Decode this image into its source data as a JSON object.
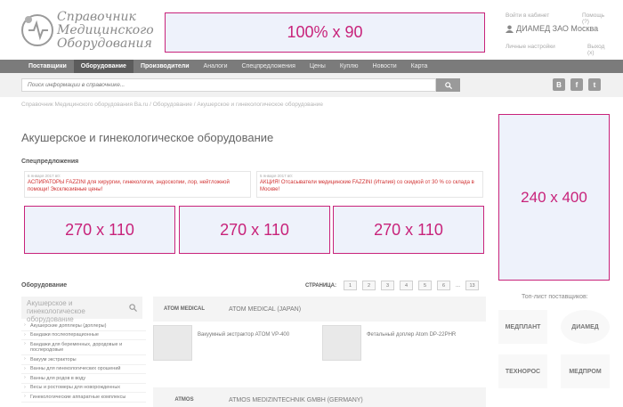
{
  "header": {
    "logo_lines": [
      "Справочник",
      "Медицинского",
      "Оборудования"
    ],
    "top_banner_label": "100% x 90"
  },
  "account": {
    "cabinet_link": "Войти в кабинет",
    "help_link": "Помощь (?)",
    "username": "ДИАМЕД ЗАО Москва",
    "settings_link": "Личные настройки",
    "logout_link": "Выход (x)"
  },
  "nav": {
    "items": [
      {
        "label": "Поставщики"
      },
      {
        "label": "Оборудование"
      },
      {
        "label": "Производители"
      },
      {
        "label": "Аналоги"
      },
      {
        "label": "Спецпредложения"
      },
      {
        "label": "Цены"
      },
      {
        "label": "Куплю"
      },
      {
        "label": "Новости"
      },
      {
        "label": "Карта"
      }
    ]
  },
  "search": {
    "placeholder": "Поиск информации в справочнике..."
  },
  "social": {
    "vk": "В",
    "fb": "f",
    "tw": "t"
  },
  "breadcrumb": "Справочник Медицинского оборудования Ва.ru / Оборудование / Акушерское и гинекологическое оборудование",
  "page_title": "Акушерское и гинекологическое оборудование",
  "special_offers": {
    "title": "Спецпредложения",
    "items": [
      {
        "date": "6 января 2017 в0:",
        "text": "АСПИРАТОРЫ FAZZINI для хирургии, гинекологии, эндоскопии, лор, нейтложной помощи! Эксклюзивные цены!"
      },
      {
        "date": "5 января 2017 в0:",
        "text": "АКЦИЯ! Отсасыватели медицинские FAZZINI (Италия) со скидкой от 30 % со склада в Москве!"
      }
    ]
  },
  "banners": {
    "b1": "270 x 110",
    "b2": "270 x 110",
    "b3": "270 x 110",
    "right": "240 x 400"
  },
  "equipment": {
    "title": "Оборудование",
    "search_text": "Акушерское и гинекологическое оборудование",
    "items": [
      "Акушерские допплеры (доплеры)",
      "Бандажи послеоперационные",
      "Бандажи для беременных, дородовые и послеродовые",
      "Вакуум экстракторы",
      "Ванны для гинекологических орошений",
      "Ванны для родов в воду",
      "Весы и ростомеры для новорожденных",
      "Гинекологические аппаратные комплексы"
    ]
  },
  "pager": {
    "label": "СТРАНИЦА:",
    "pages": [
      "1",
      "2",
      "3",
      "4",
      "5",
      "6"
    ],
    "dots": "...",
    "last": "13"
  },
  "suppliers": [
    {
      "logo": "ATOM MEDICAL",
      "name": "ATOM MEDICAL (JAPAN)"
    },
    {
      "logo": "ATMOS",
      "name": "ATMOS MEDIZINTECHNIK GMBH (GERMANY)"
    }
  ],
  "products": [
    {
      "name": "Вакуумный экстрактор ATOM VP-400"
    },
    {
      "name": "Фетальный доплер Atom DP-22PHR"
    }
  ],
  "toplist": {
    "title": "Топ-лист поставщиков:",
    "logos": [
      "МЕДПЛАНТ",
      "ДИАМЕД",
      "ТЕХНОРОС",
      "МЕДПРОМ"
    ]
  }
}
